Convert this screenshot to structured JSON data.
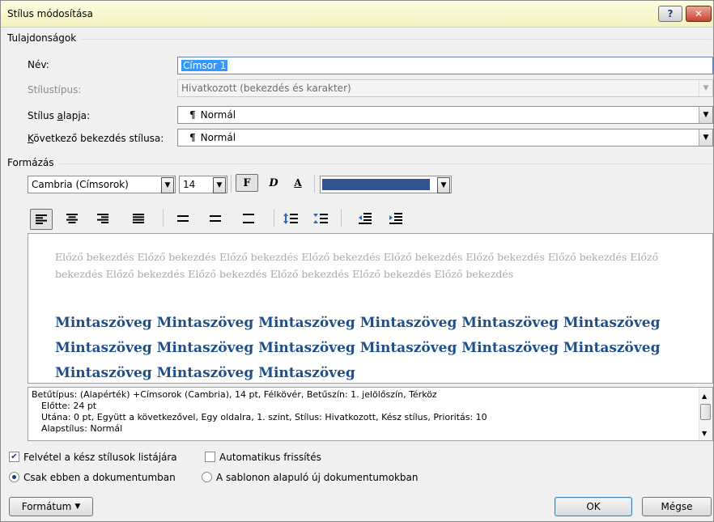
{
  "window": {
    "title": "Stílus módosítása",
    "help_label": "?",
    "close_label": "✕"
  },
  "properties": {
    "group_label": "Tulajdonságok",
    "name_label": "Név:",
    "name_value": "Címsor 1",
    "style_type_label": "Stílustípus:",
    "style_type_value": "Hivatkozott (bekezdés és karakter)",
    "based_on_label": "Stílus alapja:",
    "based_on_value": "Normál",
    "next_label": "Következő bekezdés stílusa:",
    "next_value": "Normál",
    "pilcrow": "¶"
  },
  "formatting": {
    "group_label": "Formázás",
    "font": "Cambria (Címsorok)",
    "size": "14",
    "bold_label": "F",
    "italic_label": "D",
    "underline_label": "A",
    "font_color": "#2f5491"
  },
  "preview": {
    "previous_paragraph": "Előző bekezdés Előző bekezdés Előző bekezdés Előző bekezdés Előző bekezdés Előző bekezdés Előző bekezdés Előző bekezdés Előző bekezdés Előző bekezdés Előző bekezdés Előző bekezdés Előző bekezdés",
    "sample_text": "Mintaszöveg Mintaszöveg Mintaszöveg Mintaszöveg Mintaszöveg Mintaszöveg Mintaszöveg Mintaszöveg Mintaszöveg Mintaszöveg Mintaszöveg Mintaszöveg Mintaszöveg Mintaszöveg Mintaszöveg"
  },
  "description": {
    "line1": "Betűtípus: (Alapérték) +Címsorok (Cambria), 14 pt, Félkövér, Betűszín: 1. jelölőszín, Térköz",
    "line2": "Előtte: 24 pt",
    "line3": "Utána: 0 pt, Együtt a következővel, Egy oldalra, 1. szint, Stílus: Hivatkozott, Kész stílus, Prioritás: 10",
    "line4": "Alapstílus: Normál"
  },
  "options": {
    "add_to_quick": "Felvétel a kész stílusok listájára",
    "auto_update": "Automatikus frissítés",
    "only_this_doc": "Csak ebben a dokumentumban",
    "new_docs": "A sablonon alapuló új dokumentumokban"
  },
  "buttons": {
    "format": "Formátum",
    "ok": "OK",
    "cancel": "Mégse"
  }
}
